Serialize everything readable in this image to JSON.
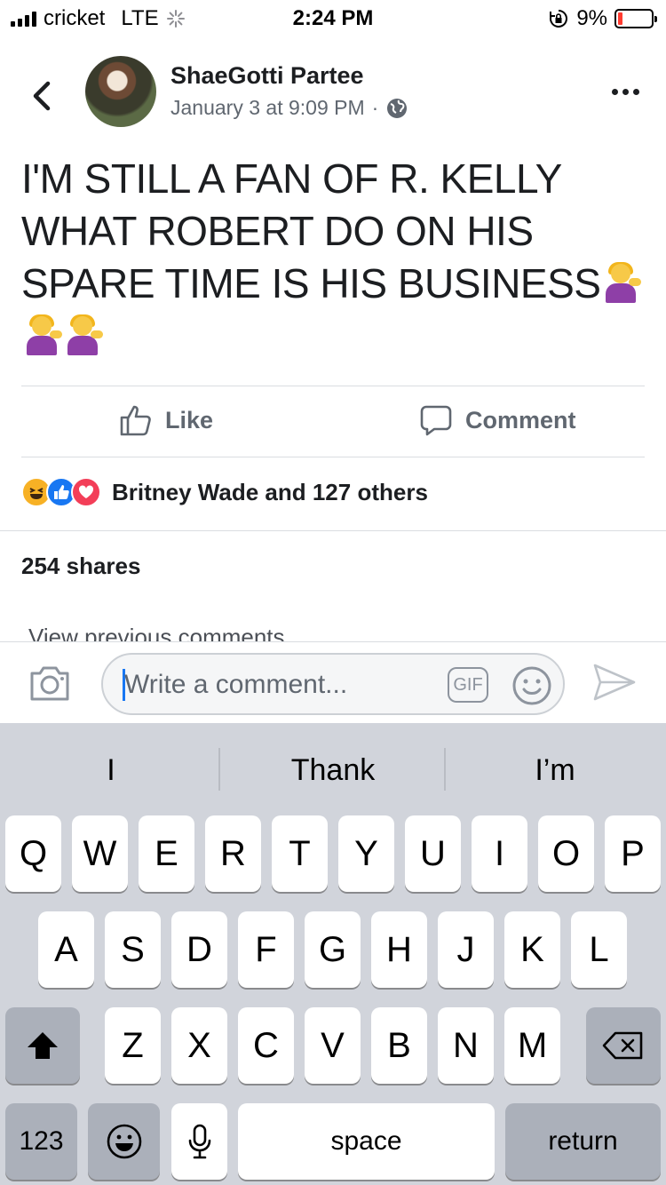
{
  "status_bar": {
    "carrier": "cricket",
    "network": "LTE",
    "time": "2:24 PM",
    "battery": "9%",
    "battery_level": 0.09
  },
  "post": {
    "author": "ShaeGotti Partee",
    "timestamp": "January 3 at 9:09 PM",
    "separator": "·",
    "privacy_icon": "globe-icon",
    "text_line1": "I'M STILL A FAN OF R. KELLY",
    "text_line2": "WHAT ROBERT DO ON HIS",
    "text_line3": "SPARE TIME IS HIS BUSINESS"
  },
  "actions": {
    "like_label": "Like",
    "comment_label": "Comment"
  },
  "reactions": {
    "summary": "Britney Wade and 127 others",
    "types": [
      "haha",
      "like",
      "love"
    ]
  },
  "shares": "254 shares",
  "view_previous": "View previous comments",
  "composer": {
    "placeholder": "Write a comment...",
    "gif_label": "GIF"
  },
  "keyboard": {
    "suggestions": [
      "I",
      "Thank",
      "I’m"
    ],
    "row1": [
      "Q",
      "W",
      "E",
      "R",
      "T",
      "Y",
      "U",
      "I",
      "O",
      "P"
    ],
    "row2": [
      "A",
      "S",
      "D",
      "F",
      "G",
      "H",
      "J",
      "K",
      "L"
    ],
    "row3": [
      "Z",
      "X",
      "C",
      "V",
      "B",
      "N",
      "M"
    ],
    "numbers_label": "123",
    "space_label": "space",
    "return_label": "return"
  },
  "colors": {
    "facebook_blue": "#1877f2",
    "text_secondary": "#606770",
    "keyboard_bg": "#d1d4db"
  }
}
